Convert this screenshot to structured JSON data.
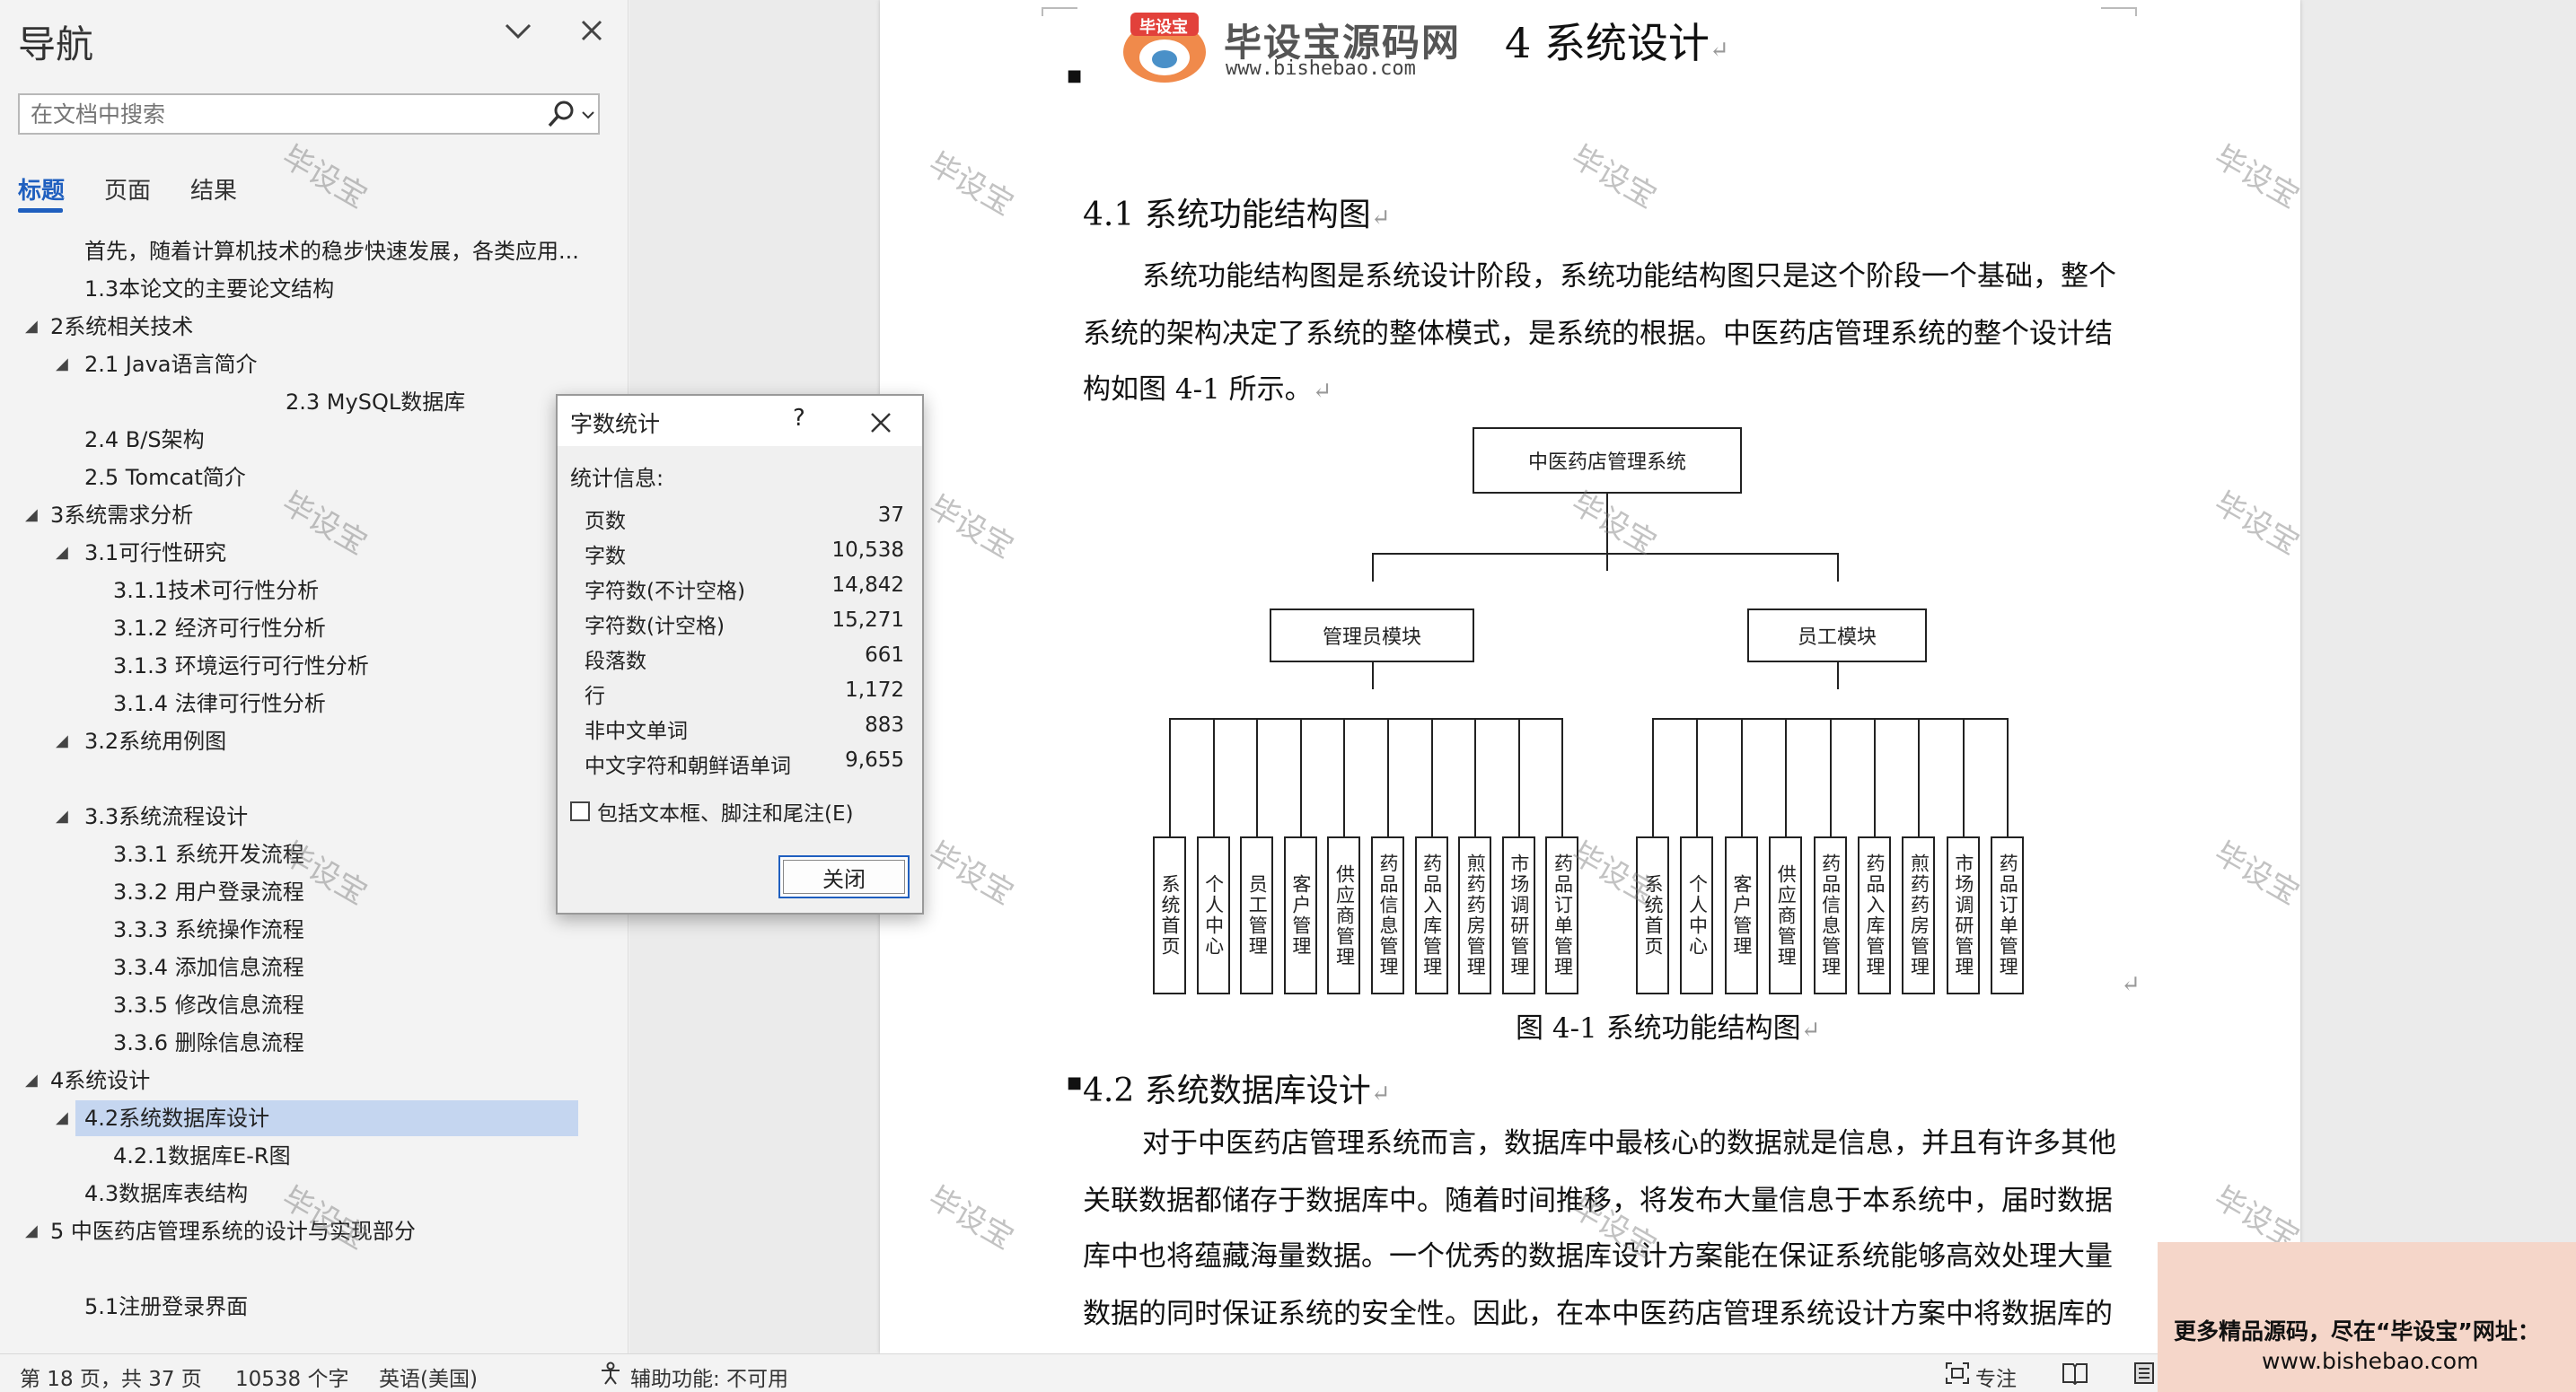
{
  "nav": {
    "title": "导航",
    "search_placeholder": "在文档中搜索",
    "tabs": [
      "标题",
      "页面",
      "结果"
    ],
    "headings": [
      {
        "label": "首先，随着计算机技术的稳步快速发展，各类应用...",
        "level": 2,
        "expand": ""
      },
      {
        "label": "1.3本论文的主要论文结构",
        "level": 2,
        "expand": ""
      },
      {
        "label": "2系统相关技术",
        "level": 1,
        "expand": "◢"
      },
      {
        "label": "2.1 Java语言简介",
        "level": 2,
        "expand": "◢"
      },
      {
        "label": "2.3 MySQL数据库",
        "level": 4,
        "expand": ""
      },
      {
        "label": "2.4 B/S架构",
        "level": 2,
        "expand": ""
      },
      {
        "label": "2.5 Tomcat简介",
        "level": 2,
        "expand": ""
      },
      {
        "label": "3系统需求分析",
        "level": 1,
        "expand": "◢"
      },
      {
        "label": "3.1可行性研究",
        "level": 2,
        "expand": "◢"
      },
      {
        "label": "3.1.1技术可行性分析",
        "level": 3,
        "expand": ""
      },
      {
        "label": "3.1.2 经济可行性分析",
        "level": 3,
        "expand": ""
      },
      {
        "label": "3.1.3 环境运行可行性分析",
        "level": 3,
        "expand": ""
      },
      {
        "label": "3.1.4 法律可行性分析",
        "level": 3,
        "expand": ""
      },
      {
        "label": "3.2系统用例图",
        "level": 2,
        "expand": "◢"
      },
      {
        "label": "",
        "level": 2,
        "expand": ""
      },
      {
        "label": "3.3系统流程设计",
        "level": 2,
        "expand": "◢"
      },
      {
        "label": "3.3.1 系统开发流程",
        "level": 3,
        "expand": ""
      },
      {
        "label": "3.3.2 用户登录流程",
        "level": 3,
        "expand": ""
      },
      {
        "label": "3.3.3 系统操作流程",
        "level": 3,
        "expand": ""
      },
      {
        "label": "3.3.4 添加信息流程",
        "level": 3,
        "expand": ""
      },
      {
        "label": "3.3.5 修改信息流程",
        "level": 3,
        "expand": ""
      },
      {
        "label": "3.3.6 删除信息流程",
        "level": 3,
        "expand": ""
      },
      {
        "label": "4系统设计",
        "level": 1,
        "expand": "◢"
      },
      {
        "label": "4.2系统数据库设计",
        "level": 2,
        "expand": "◢",
        "selected": true
      },
      {
        "label": "4.2.1数据库E-R图",
        "level": 3,
        "expand": ""
      },
      {
        "label": "4.3数据库表结构",
        "level": 2,
        "expand": ""
      },
      {
        "label": "5 中医药店管理系统的设计与实现部分",
        "level": 1,
        "expand": "◢"
      },
      {
        "label": "",
        "level": 2,
        "expand": ""
      },
      {
        "label": "5.1注册登录界面",
        "level": 2,
        "expand": ""
      }
    ]
  },
  "dialog": {
    "title": "字数统计",
    "help": "?",
    "section": "统计信息:",
    "stats": [
      {
        "k": "页数",
        "v": "37"
      },
      {
        "k": "字数",
        "v": "10,538"
      },
      {
        "k": "字符数(不计空格)",
        "v": "14,842"
      },
      {
        "k": "字符数(计空格)",
        "v": "15,271"
      },
      {
        "k": "段落数",
        "v": "661"
      },
      {
        "k": "行",
        "v": "1,172"
      },
      {
        "k": "非中文单词",
        "v": "883"
      },
      {
        "k": "中文字符和朝鲜语单词",
        "v": "9,655"
      }
    ],
    "checkbox_label": "包括文本框、脚注和尾注(E)",
    "close_label": "关闭"
  },
  "doc": {
    "logo_cn": "毕设宝源码网",
    "logo_url": "www.bishebao.com",
    "logo_badge": "毕设宝",
    "chapter": "4 系统设计",
    "h41": "4.1 系统功能结构图",
    "p1": [
      "系统功能结构图是系统设计阶段，系统功能结构图只是这个阶段一个基础，整个",
      "系统的架构决定了系统的整体模式，是系统的根据。中医药店管理系统的整个设计结",
      "构如图 4-1 所示。"
    ],
    "caption": "图 4-1 系统功能结构图",
    "h42": "4.2 系统数据库设计",
    "p2": [
      "对于中医药店管理系统而言，数据库中最核心的数据就是信息，并且有许多其他",
      "关联数据都储存于数据库中。随着时间推移，将发布大量信息于本系统中，届时数据",
      "库中也将蕴藏海量数据。一个优秀的数据库设计方案能在保证系统能够高效处理大量",
      "数据的同时保证系统的安全性。因此，在本中医药店管理系统设计方案中将数据库的"
    ],
    "para_mark": "↵",
    "watermark": "毕设宝"
  },
  "diagram": {
    "root": "中医药店管理系统",
    "admin": "管理员模块",
    "staff": "员工模块",
    "admin_leaves": [
      "系统首页",
      "个人中心",
      "员工管理",
      "客户管理",
      "供应商管理",
      "药品信息管理",
      "药品入库管理",
      "煎药药房管理",
      "市场调研管理",
      "药品订单管理"
    ],
    "staff_leaves": [
      "系统首页",
      "个人中心",
      "客户管理",
      "供应商管理",
      "药品信息管理",
      "药品入库管理",
      "煎药药房管理",
      "市场调研管理",
      "药品订单管理"
    ]
  },
  "status": {
    "page": "第 18 页，共 37 页",
    "words": "10538 个字",
    "lang": "英语(美国)",
    "access": "辅助功能: 不可用",
    "focus": "专注"
  },
  "ad": {
    "line1": "更多精品源码，尽在“毕设宝”网址：",
    "line2": "www.bishebao.com"
  }
}
